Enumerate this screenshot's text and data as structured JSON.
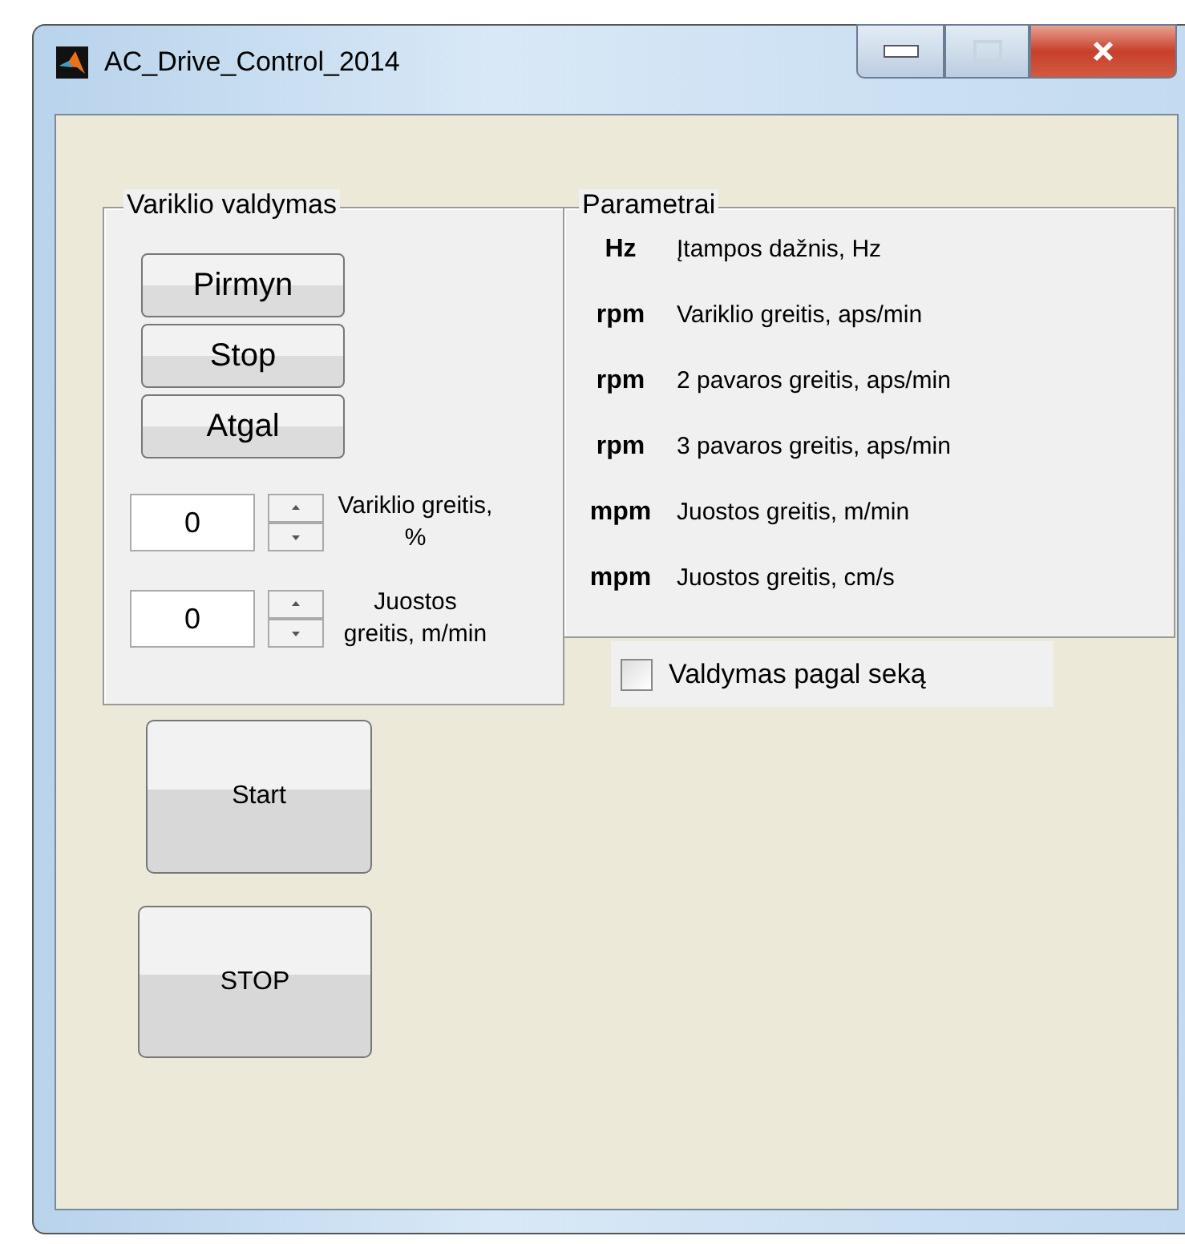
{
  "window": {
    "title": "AC_Drive_Control_2014"
  },
  "motor_panel": {
    "title": "Variklio valdymas",
    "buttons": [
      {
        "label": "Pirmyn"
      },
      {
        "label": "Stop"
      },
      {
        "label": "Atgal"
      }
    ],
    "inputs": [
      {
        "value": "0",
        "label": "Variklio greitis, %"
      },
      {
        "value": "0",
        "label": "Juostos greitis, m/min"
      }
    ]
  },
  "parameters_panel": {
    "title": "Parametrai",
    "rows": [
      {
        "unit": "Hz",
        "description": "Įtampos dažnis, Hz"
      },
      {
        "unit": "rpm",
        "description": "Variklio greitis, aps/min"
      },
      {
        "unit": "rpm",
        "description": "2 pavaros greitis, aps/min"
      },
      {
        "unit": "rpm",
        "description": "3 pavaros greitis, aps/min"
      },
      {
        "unit": "mpm",
        "description": "Juostos greitis, m/min"
      },
      {
        "unit": "mpm",
        "description": "Juostos greitis, cm/s"
      }
    ]
  },
  "sequence_checkbox": {
    "label": "Valdymas pagal seką",
    "checked": false
  },
  "big_buttons": [
    {
      "label": "Start"
    },
    {
      "label": "STOP"
    }
  ]
}
